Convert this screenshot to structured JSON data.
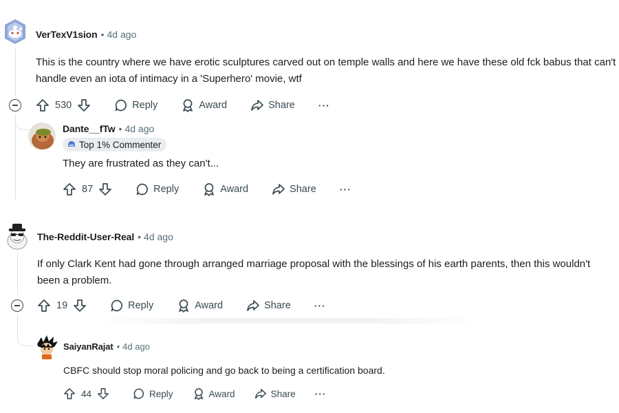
{
  "comments": [
    {
      "author": "VerTexV1sion",
      "time": "4d ago",
      "body": "This is the country where we have erotic sculptures carved out on temple walls and here we have these old fck babus that can't handle even an iota of intimacy in a 'Superhero' movie, wtf",
      "score": "530",
      "reply_label": "Reply",
      "award_label": "Award",
      "share_label": "Share",
      "more_label": "···"
    },
    {
      "author": "Dante__fTw",
      "time": "4d ago",
      "badge": "Top 1% Commenter",
      "body": "They are frustrated as they can't...",
      "score": "87",
      "reply_label": "Reply",
      "award_label": "Award",
      "share_label": "Share",
      "more_label": "···"
    },
    {
      "author": "The-Reddit-User-Real",
      "time": "4d ago",
      "body": "If only Clark Kent had gone through arranged marriage proposal with the blessings of his earth parents, then this wouldn't been a problem.",
      "score": "19",
      "reply_label": "Reply",
      "award_label": "Award",
      "share_label": "Share",
      "more_label": "···"
    },
    {
      "author": "SaiyanRajat",
      "time": "4d ago",
      "body": "CBFC should stop moral policing and go back to being a certification board.",
      "score": "44",
      "reply_label": "Reply",
      "award_label": "Award",
      "share_label": "Share",
      "more_label": "···"
    }
  ],
  "separator": "•",
  "colors": {
    "text": "#1c1c1c",
    "meta": "#576f76",
    "action": "#3a4a51",
    "thread_line": "#dfe3e6",
    "badge_bg": "#eaedef"
  }
}
